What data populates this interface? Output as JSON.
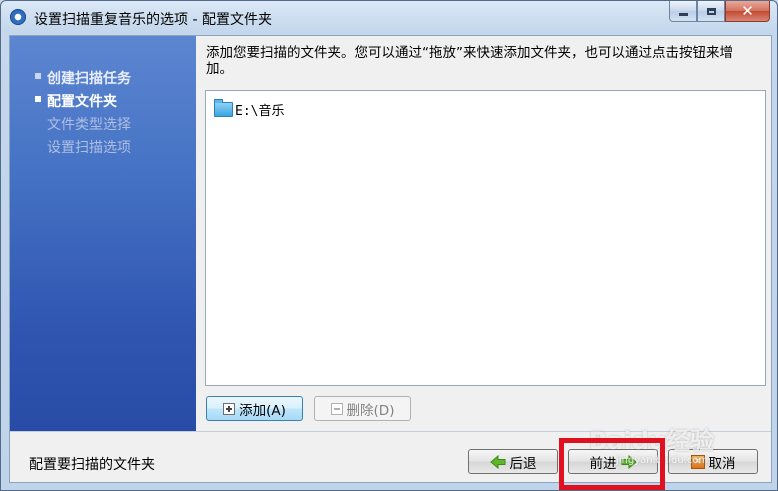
{
  "window": {
    "title": "设置扫描重复音乐的选项 - 配置文件夹",
    "caption_buttons": [
      "minimize",
      "maximize",
      "close"
    ]
  },
  "steps": [
    {
      "label": "创建扫描任务",
      "state": "done"
    },
    {
      "label": "配置文件夹",
      "state": "current"
    },
    {
      "label": "文件类型选择",
      "state": "pending"
    },
    {
      "label": "设置扫描选项",
      "state": "pending"
    }
  ],
  "description": "添加您要扫描的文件夹。您可以通过“拖放”来快速添加文件夹，也可以通过点击按钮来增加。",
  "folders": [
    {
      "path": "E:\\音乐",
      "icon": "folder-icon"
    }
  ],
  "buttons": {
    "add": "添加(A)",
    "delete": "删除(D)",
    "back": "后退",
    "next": "前进",
    "cancel": "取消"
  },
  "status_text": "配置要扫描的文件夹",
  "watermark": {
    "brand": "Baidu经验",
    "url": "jingyan.baidu.com"
  },
  "colors": {
    "sidebar": "#3b63bd",
    "highlight_box": "#e0111e",
    "close_button": "#c24a33"
  }
}
